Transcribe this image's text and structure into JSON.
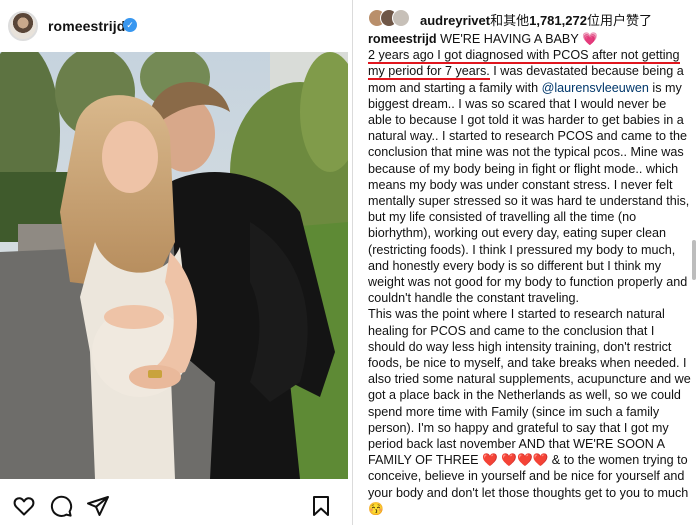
{
  "post": {
    "username": "romeestrijd",
    "verified_badge": "✓",
    "photo_alt": ""
  },
  "actions": [
    "heart-icon",
    "comment-icon",
    "share-icon",
    "bookmark-icon"
  ],
  "likes": {
    "first_user": "audreyrivet",
    "and_others": "和其他",
    "count": "1,781,272",
    "suffix": "位用户赞了"
  },
  "caption": {
    "username": "romeestrijd",
    "headline": "WE'RE HAVING A BABY",
    "headline_emoji": "💗",
    "underlined": "2 years ago I got diagnosed with PCOS after not getting my period for 7 years.",
    "p1_a": " I was devastated because being a mom and starting a family with ",
    "mention": "@laurensvleeuwen",
    "p1_b": " is my biggest dream.. I was so scared that I would never be able to because I got told it was harder to get babies in a natural way.. I started to research PCOS and came to the conclusion that mine was not the typical pcos.. Mine was because of my body being in fight or flight mode.. which means my body was under constant stress. I never felt mentally super stressed so it was hard te understand this, but my life consisted of travelling all the time (no biorhythm), working out every day, eating super clean (restricting foods). I think I pressured my body to much, and honestly every body is so different but I think my weight was not good for my body to function properly and couldn't handle the constant traveling.",
    "p2_a": "This was the point where I started to research natural healing for PCOS and came to the conclusion that I should do way less high intensity training, don't restrict foods, be nice to myself, and take breaks when needed. I also tried some natural supplements, acupuncture and we got a place back in the Netherlands as well, so we could spend more time with Family (since im such a family person). I'm so happy and grateful to say that I got my period back last november AND that WE'RE SOON A FAMILY OF THREE ",
    "hearts": "❤️ ❤️❤️❤️",
    "p2_b": " & to the women trying to conceive, believe in yourself and be nice for yourself and your body and don't let those thoughts get to you to much ",
    "end_emoji": "😚"
  },
  "colors": {
    "verified": "#3897f0",
    "underline": "#e0161e",
    "mention": "#00376b"
  }
}
